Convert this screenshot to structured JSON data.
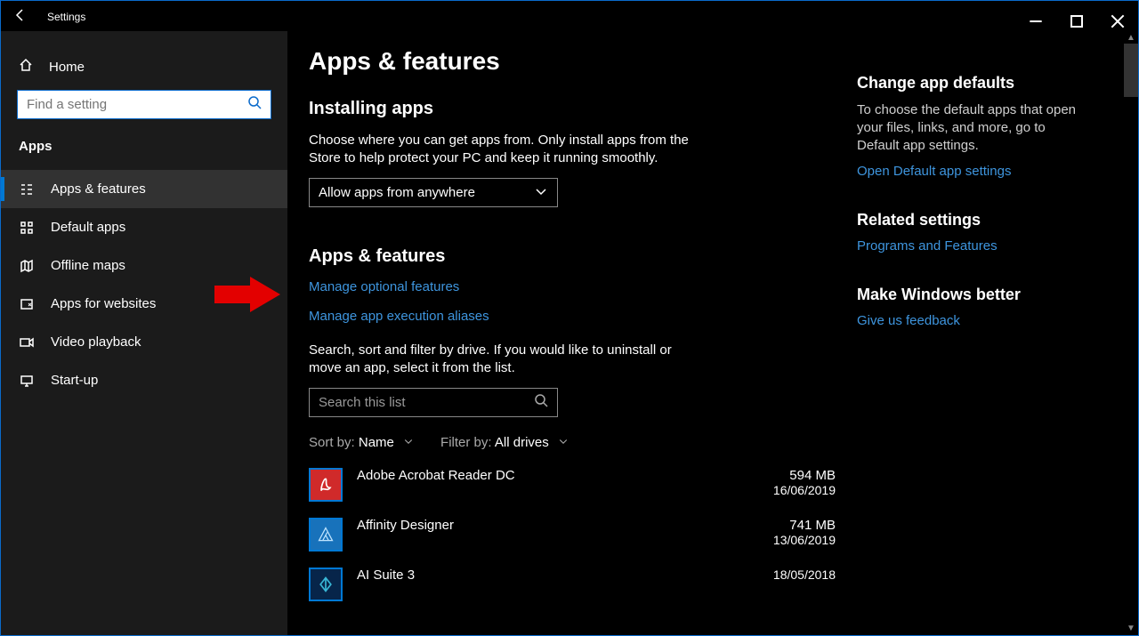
{
  "titlebar": {
    "title": "Settings"
  },
  "sidebar": {
    "home": "Home",
    "search_placeholder": "Find a setting",
    "section": "Apps",
    "items": [
      {
        "label": "Apps & features"
      },
      {
        "label": "Default apps"
      },
      {
        "label": "Offline maps"
      },
      {
        "label": "Apps for websites"
      },
      {
        "label": "Video playback"
      },
      {
        "label": "Start-up"
      }
    ]
  },
  "main": {
    "page_title": "Apps & features",
    "installing_heading": "Installing apps",
    "installing_body": "Choose where you can get apps from. Only install apps from the Store to help protect your PC and keep it running smoothly.",
    "installing_dropdown": "Allow apps from anywhere",
    "apps_heading": "Apps & features",
    "link_optional": "Manage optional features",
    "link_aliases": "Manage app execution aliases",
    "filter_body": "Search, sort and filter by drive. If you would like to uninstall or move an app, select it from the list.",
    "search_placeholder": "Search this list",
    "sort_label": "Sort by:",
    "sort_value": "Name",
    "filter_label": "Filter by:",
    "filter_value": "All drives",
    "apps": [
      {
        "name": "Adobe Acrobat Reader DC",
        "size": "594 MB",
        "date": "16/06/2019",
        "icon": "acrobat"
      },
      {
        "name": "Affinity Designer",
        "size": "741 MB",
        "date": "13/06/2019",
        "icon": "affinity"
      },
      {
        "name": "AI Suite 3",
        "size": "",
        "date": "18/05/2018",
        "icon": "aisuite"
      }
    ]
  },
  "aside": {
    "defaults_heading": "Change app defaults",
    "defaults_body": "To choose the default apps that open your files, links, and more, go to Default app settings.",
    "defaults_link": "Open Default app settings",
    "related_heading": "Related settings",
    "related_link": "Programs and Features",
    "better_heading": "Make Windows better",
    "better_link": "Give us feedback"
  }
}
